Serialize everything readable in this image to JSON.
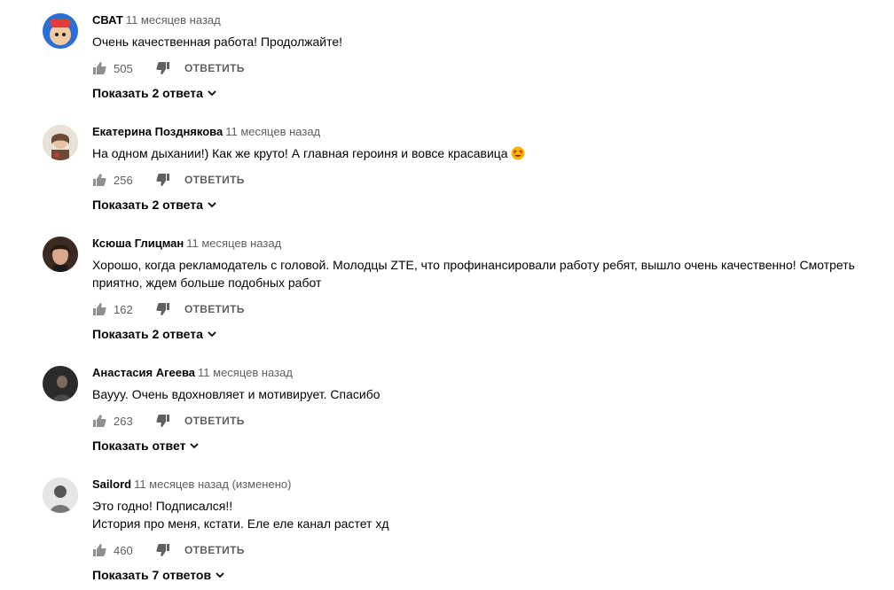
{
  "comments": [
    {
      "author": "СВАТ",
      "time": "11 месяцев назад",
      "lines": [
        "Очень качественная работа! Продолжайте!"
      ],
      "likes": "505",
      "reply_label": "ОТВЕТИТЬ",
      "replies_label": "Показать 2 ответа",
      "avatar_colors": [
        "#2b6fd6",
        "#e33b3b"
      ]
    },
    {
      "author": "Екатерина Позднякова",
      "time": "11 месяцев назад",
      "lines": [
        "На одном дыхании!)  Как же круто!  А главная героиня и вовсе красавица"
      ],
      "likes": "256",
      "reply_label": "ОТВЕТИТЬ",
      "replies_label": "Показать 2 ответа",
      "avatar_colors": [
        "#d9c9b8",
        "#6b4a36"
      ]
    },
    {
      "author": "Ксюша Глицман",
      "time": "11 месяцев назад",
      "lines": [
        "Хорошо, когда рекламодатель с головой. Молодцы ZTE, что профинансировали работу ребят, вышло очень качественно! Смотреть",
        "приятно, ждем больше подобных работ"
      ],
      "likes": "162",
      "reply_label": "ОТВЕТИТЬ",
      "replies_label": "Показать 2 ответа",
      "avatar_colors": [
        "#3a2a22",
        "#c99a80"
      ]
    },
    {
      "author": "Анастасия Агеева",
      "time": "11 месяцев назад",
      "lines": [
        "Вауyy. Очень вдохновляет и мотивирует. Спасибо"
      ],
      "likes": "263",
      "reply_label": "ОТВЕТИТЬ",
      "replies_label": "Показать ответ",
      "avatar_colors": [
        "#2a2a2a",
        "#7a6a5a"
      ]
    },
    {
      "author": "Sailord",
      "time": "11 месяцев назад (изменено)",
      "lines": [
        "Это годно! Подписался!!",
        "История про меня, кстати. Еле еле канал растет хд"
      ],
      "likes": "460",
      "reply_label": "ОТВЕТИТЬ",
      "replies_label": "Показать 7 ответов",
      "avatar_colors": [
        "#e6e6e6",
        "#555555"
      ]
    }
  ]
}
